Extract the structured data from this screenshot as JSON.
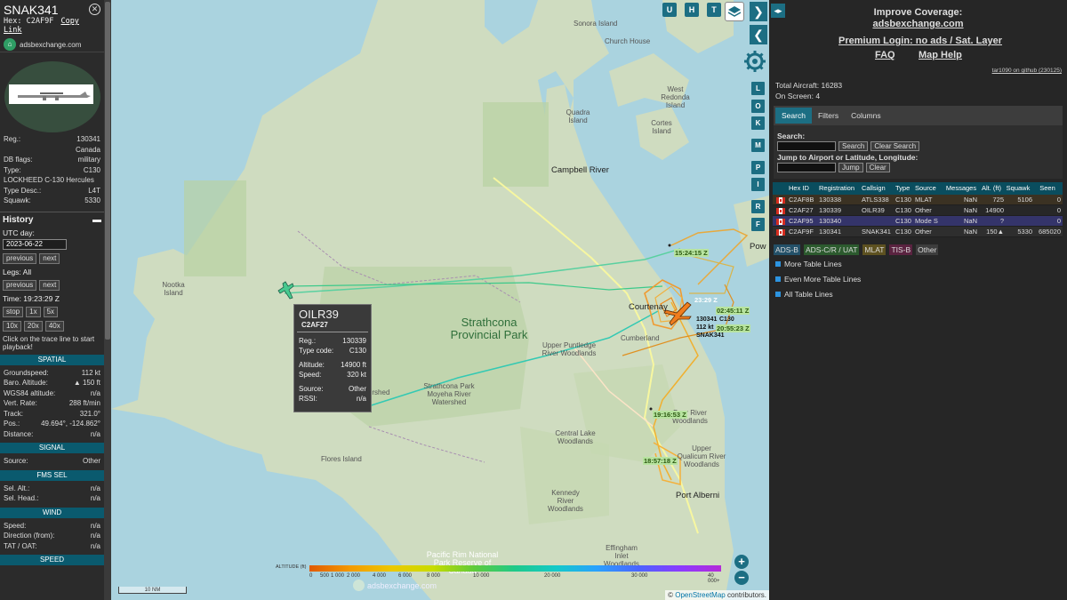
{
  "left": {
    "callsign": "SNAK341",
    "hex_label": "Hex:",
    "hex": "C2AF9F",
    "copy_link": "Copy Link",
    "site": "adsbexchange.com",
    "info": [
      {
        "k": "Reg.:",
        "v": "130341"
      },
      {
        "k": "",
        "v": "Canada"
      },
      {
        "k": "DB flags:",
        "v": "military"
      },
      {
        "k": "Type:",
        "v": "C130"
      },
      {
        "k": "LOCKHEED C-130 Hercules",
        "v": ""
      },
      {
        "k": "Type Desc.:",
        "v": "L4T"
      },
      {
        "k": "Squawk:",
        "v": "5330"
      }
    ],
    "history": {
      "title": "History",
      "utc_day_label": "UTC day:",
      "date": "2023-06-22",
      "prev": "previous",
      "next": "next",
      "legs_label": "Legs: All",
      "time_label": "Time: 19:23:29 Z",
      "speeds1": [
        "stop",
        "1x",
        "5x"
      ],
      "speeds2": [
        "10x",
        "20x",
        "40x"
      ],
      "note": "Click on the trace line to start playback!"
    },
    "spatial": {
      "title": "SPATIAL",
      "rows": [
        {
          "k": "Groundspeed:",
          "v": "112 kt"
        },
        {
          "k": "Baro. Altitude:",
          "v": "▲ 150 ft"
        },
        {
          "k": "WGS84 altitude:",
          "v": "n/a"
        },
        {
          "k": "Vert. Rate:",
          "v": "288 ft/min"
        },
        {
          "k": "Track:",
          "v": "321.0°"
        },
        {
          "k": "Pos.:",
          "v": "49.694°, -124.862°"
        },
        {
          "k": "Distance:",
          "v": "n/a"
        }
      ]
    },
    "signal": {
      "title": "SIGNAL",
      "rows": [
        {
          "k": "Source:",
          "v": "Other"
        }
      ]
    },
    "fms": {
      "title": "FMS SEL",
      "rows": [
        {
          "k": "Sel. Alt.:",
          "v": "n/a"
        },
        {
          "k": "Sel. Head.:",
          "v": "n/a"
        }
      ]
    },
    "wind": {
      "title": "WIND",
      "rows": [
        {
          "k": "Speed:",
          "v": "n/a"
        },
        {
          "k": "Direction (from):",
          "v": "n/a"
        },
        {
          "k": "TAT / OAT:",
          "v": "n/a"
        }
      ]
    },
    "speed": {
      "title": "SPEED"
    }
  },
  "map": {
    "layer_buttons": [
      "U",
      "H",
      "T"
    ],
    "side_buttons": [
      "L",
      "O",
      "K",
      "M",
      "P",
      "I",
      "R",
      "F"
    ],
    "places": {
      "sonora": "Sonora Island",
      "church": "Church House",
      "westredonda": "West Redonda Island",
      "quadra": "Quadra Island",
      "cortes": "Cortes Island",
      "campbell": "Campbell River",
      "nootka": "Nootka Island",
      "strathcona": "Strathcona Provincial Park",
      "courtenay": "Courtenay",
      "cumberland": "Cumberland",
      "upperpunt": "Upper Puntledge River Woodlands",
      "moyeha": "Strathcona Park Moyeha River Watershed",
      "cpw": "Watershed",
      "central": "Central Lake Woodlands",
      "upperq": "Upper Qualicum River Woodlands",
      "flores": "Flores Island",
      "kennedy": "Kennedy River Woodlands",
      "portalberni": "Port Alberni",
      "effingham": "Effingham Inlet Woodlands",
      "pacific": "Pacific Rim National Park Reserve of Canada",
      "powell": "Pow",
      "bear": "Bear River Woodlands"
    },
    "times": [
      "15:24:15 Z",
      "23:29 Z",
      "02:45:11 Z",
      "20:55:23 Z",
      "19:16:53 Z",
      "18:57:18 Z"
    ],
    "cluster_labels": [
      "130341",
      "C130",
      "112 kt",
      "SNAK341"
    ],
    "tooltip": {
      "callsign": "OILR39",
      "hex": "C2AF27",
      "rows": [
        {
          "k": "Reg.:",
          "v": "130339"
        },
        {
          "k": "Type code:",
          "v": "C130"
        },
        {
          "k": "Altitude:",
          "v": "14900 ft"
        },
        {
          "k": "Speed:",
          "v": "320 kt"
        },
        {
          "k": "Source:",
          "v": "Other"
        },
        {
          "k": "RSSI:",
          "v": "n/a"
        }
      ]
    },
    "legend": {
      "title": "ALTITUDE (ft)",
      "ticks": [
        "0",
        "500",
        "1 000",
        "2 000",
        "4 000",
        "6 000",
        "8 000",
        "10 000",
        "20 000",
        "30 000",
        "40 000+"
      ]
    },
    "scale": "10 NM",
    "watermark": "adsbexchange.com",
    "attribution_pre": "©",
    "attribution_link": "OpenStreetMap",
    "attribution_post": "contributors."
  },
  "right": {
    "improve": "Improve Coverage:",
    "improve_link": "adsbexchange.com",
    "premium": "Premium Login: no ads / Sat. Layer",
    "faq": "FAQ",
    "maphelp": "Map Help",
    "version": "tar1090 on github (230125)",
    "total": "Total Aircraft: 16283",
    "onscreen": "On Screen: 4",
    "tabs": [
      "Search",
      "Filters",
      "Columns"
    ],
    "search_label": "Search:",
    "search_btn": "Search",
    "clear_search_btn": "Clear Search",
    "jump_label": "Jump to Airport or Latitude, Longitude:",
    "jump_btn": "Jump",
    "clear_btn": "Clear",
    "table_headers": [
      "",
      "Hex ID",
      "Registration",
      "Callsign",
      "Type",
      "Source",
      "Messages",
      "Alt. (ft)",
      "Squawk",
      "Seen"
    ],
    "rows": [
      {
        "hex": "C2AF8B",
        "reg": "130338",
        "cs": "ATLS338",
        "type": "C130",
        "src": "MLAT",
        "msgs": "NaN",
        "alt": "725",
        "sq": "5106",
        "seen": "0"
      },
      {
        "hex": "C2AF27",
        "reg": "130339",
        "cs": "OILR39",
        "type": "C130",
        "src": "Other",
        "msgs": "NaN",
        "alt": "14900",
        "sq": "",
        "seen": "0"
      },
      {
        "hex": "C2AF95",
        "reg": "130340",
        "cs": "",
        "type": "C130",
        "src": "Mode S",
        "msgs": "NaN",
        "alt": "?",
        "sq": "",
        "seen": "0"
      },
      {
        "hex": "C2AF9F",
        "reg": "130341",
        "cs": "SNAK341",
        "type": "C130",
        "src": "Other",
        "msgs": "NaN",
        "alt": "150▲",
        "sq": "5330",
        "seen": "685020"
      }
    ],
    "sources": [
      {
        "label": "ADS-B",
        "bg": "#235068"
      },
      {
        "label": "ADS-C/R / UAT",
        "bg": "#2c5a2e"
      },
      {
        "label": "MLAT",
        "bg": "#5d5120"
      },
      {
        "label": "TIS-B",
        "bg": "#5a2340"
      },
      {
        "label": "Other",
        "bg": "#3d3d3d"
      }
    ],
    "options": [
      "More Table Lines",
      "Even More Table Lines",
      "All Table Lines"
    ]
  },
  "colors": {
    "accent": "#1c6e83",
    "selected_row": "#34346a",
    "track": "#f0a030"
  }
}
